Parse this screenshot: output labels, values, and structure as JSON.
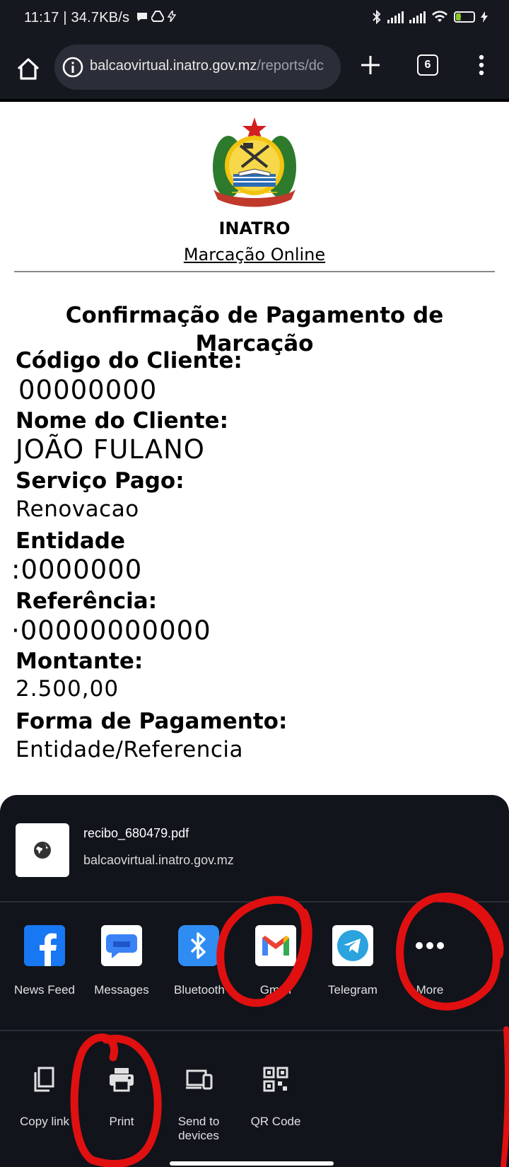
{
  "status_bar": {
    "time_speed": "11:17 | 34.7KB/s",
    "battery_level": "25"
  },
  "browser": {
    "url_host": "balcaovirtual.inatro.gov.mz",
    "url_path": "/reports/dc",
    "tab_count": "6"
  },
  "document": {
    "org": "INATRO",
    "subtitle_link": "Marcação Online",
    "title": "Confirmação de Pagamento de Marcação",
    "fields": [
      {
        "label": "Código do Cliente:",
        "value": "00000000"
      },
      {
        "label": "Nome do Cliente:",
        "value": "JOÃO FULANO"
      },
      {
        "label": "Serviço Pago:",
        "value": "Renovacao"
      },
      {
        "label": "Entidade",
        "value": ":0000000"
      },
      {
        "label": "Referência:",
        "value": "·00000000000"
      },
      {
        "label": "Montante:",
        "value": "2.500,00"
      },
      {
        "label": "Forma de Pagamento:",
        "value": "Entidade/Referencia"
      }
    ]
  },
  "share_sheet": {
    "file_name": "recibo_680479.pdf",
    "file_host": "balcaovirtual.inatro.gov.mz",
    "apps": [
      {
        "label": "News Feed",
        "icon": "facebook-icon"
      },
      {
        "label": "Messages",
        "icon": "messages-icon"
      },
      {
        "label": "Bluetooth",
        "icon": "bluetooth-icon"
      },
      {
        "label": "Gmail",
        "icon": "gmail-icon"
      },
      {
        "label": "Telegram",
        "icon": "telegram-icon"
      },
      {
        "label": "More",
        "icon": "more-dots-icon"
      }
    ],
    "actions": [
      {
        "label": "Copy link",
        "icon": "copy-icon"
      },
      {
        "label": "Print",
        "icon": "print-icon"
      },
      {
        "label": "Send to devices",
        "icon": "devices-icon"
      },
      {
        "label": "QR Code",
        "icon": "qr-code-icon"
      }
    ]
  },
  "colors": {
    "annotation_red": "#e01010",
    "facebook_blue": "#1877f2",
    "telegram_blue": "#2aa3df",
    "bluetooth_blue": "#2f8cf3"
  }
}
